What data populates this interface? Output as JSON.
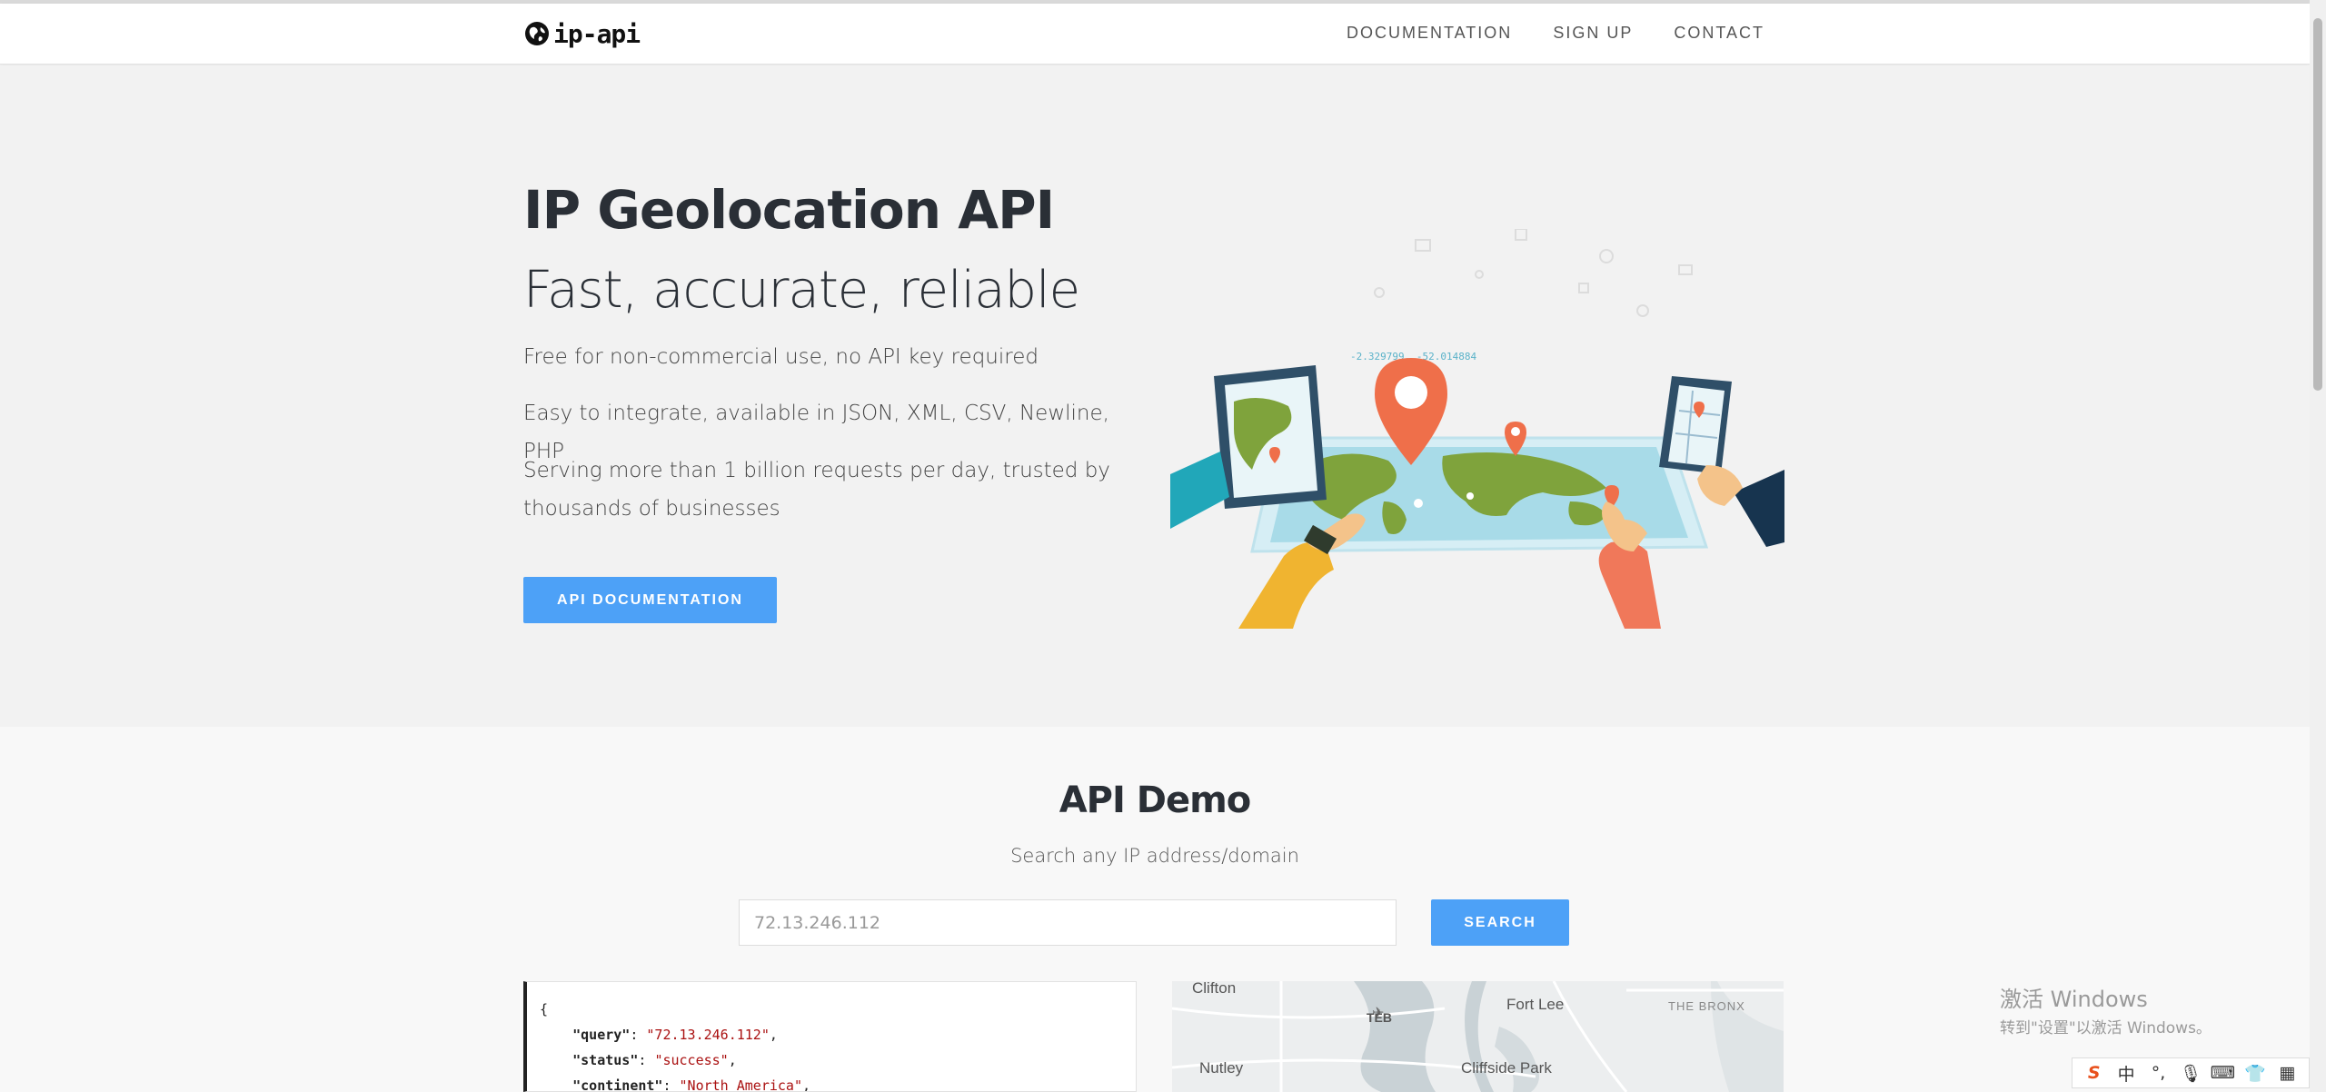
{
  "brand": {
    "name": "ip-api"
  },
  "nav": {
    "items": [
      "DOCUMENTATION",
      "SIGN UP",
      "CONTACT"
    ]
  },
  "hero": {
    "title": "IP Geolocation API",
    "subtitle": "Fast, accurate, reliable",
    "lines": [
      "Free for non-commercial use, no API key required",
      "Easy to integrate, available in JSON, XML, CSV, Newline, PHP",
      "Serving more than 1 billion requests per day, trusted by thousands of businesses"
    ],
    "button": "API DOCUMENTATION",
    "illustration_coords": "-2.329799, -52.014884"
  },
  "demo": {
    "title": "API Demo",
    "subtitle": "Search any IP address/domain",
    "input_placeholder": "72.13.246.112",
    "search_button": "SEARCH",
    "json_open": "{",
    "json_lines": [
      {
        "key": "\"query\"",
        "value": "\"72.13.246.112\""
      },
      {
        "key": "\"status\"",
        "value": "\"success\""
      },
      {
        "key": "\"continent\"",
        "value": "\"North America\""
      }
    ],
    "map_labels": {
      "clifton": "Clifton",
      "teb": "TEB",
      "fort_lee": "Fort Lee",
      "bronx": "THE BRONX",
      "nutley": "Nutley",
      "cliffside": "Cliffside Park"
    }
  },
  "watermark": {
    "title": "激活 Windows",
    "subtitle": "转到\"设置\"以激活 Windows。"
  },
  "ime_tray": {
    "items": [
      "S",
      "中",
      "°,",
      "🎙",
      "⌨",
      "👕",
      "▦"
    ]
  },
  "colors": {
    "accent": "#4da1f7",
    "map_pin": "#ef6f4a",
    "land": "#7fa33c",
    "ocean": "#a8dbe8"
  }
}
